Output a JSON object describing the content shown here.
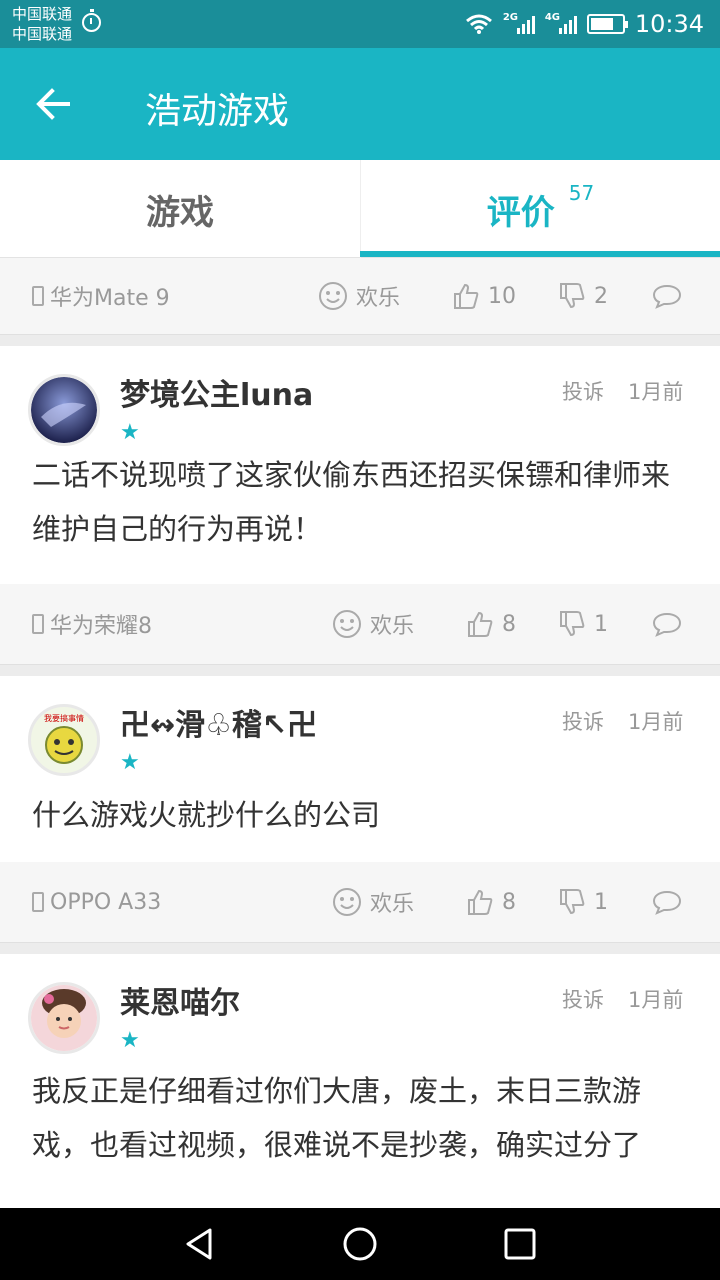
{
  "status_bar": {
    "carrier_1": "中国联通",
    "carrier_2": "中国联通",
    "net_1": "2G",
    "net_2": "4G",
    "time": "10:34"
  },
  "app_bar": {
    "title": "浩动游戏",
    "back_icon": "arrow-left-icon"
  },
  "tabs": [
    {
      "label": "游戏",
      "active": false
    },
    {
      "label": "评价",
      "count": "57",
      "active": true
    }
  ],
  "colors": {
    "accent": "#1ab5c4",
    "status_bar": "#1a8e99",
    "text": "#333333",
    "muted": "#999999"
  },
  "top_footer": {
    "device": "华为Mate 9",
    "mood": "欢乐",
    "likes": "10",
    "dislikes": "2"
  },
  "reviews": [
    {
      "username": "梦境公主luna",
      "report": "投诉",
      "time": "1月前",
      "rating": "★",
      "content": "二话不说现喷了这家伙偷东西还招买保镖和律师来维护自己的行为再说！",
      "device": "华为荣耀8",
      "mood": "欢乐",
      "likes": "8",
      "dislikes": "1"
    },
    {
      "username": "卍↭滑♧稽↖卍",
      "report": "投诉",
      "time": "1月前",
      "rating": "★",
      "content": "什么游戏火就抄什么的公司",
      "avatar_text": "我要搞事情",
      "device": "OPPO A33",
      "mood": "欢乐",
      "likes": "8",
      "dislikes": "1"
    },
    {
      "username": "莱恩喵尔",
      "report": "投诉",
      "time": "1月前",
      "rating": "★",
      "content": "我反正是仔细看过你们大唐，废土，末日三款游戏，也看过视频，很难说不是抄袭，确实过分了"
    }
  ],
  "nav_bar": {
    "back": "triangle-back-icon",
    "home": "circle-home-icon",
    "recent": "square-recent-icon"
  }
}
